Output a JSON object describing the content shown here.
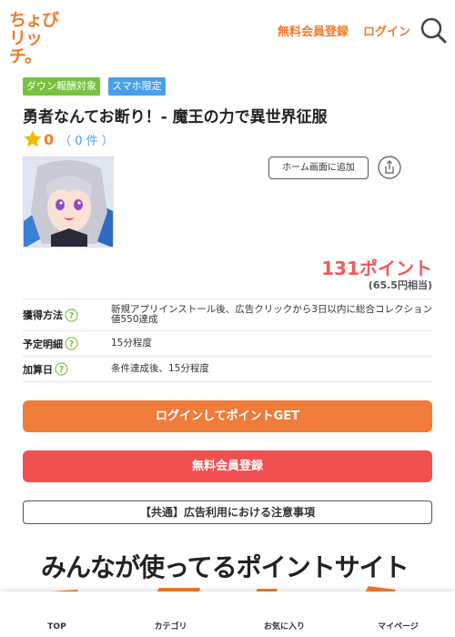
{
  "header": {
    "logo_line1": "ちょび",
    "logo_line2": "リッチ。",
    "register_label": "無料会員登録",
    "login_label": "ログイン",
    "search_icon": "search-icon"
  },
  "badges": [
    "ダウン報酬対象",
    "スマホ限定"
  ],
  "offer": {
    "title": "勇者なんてお断り！- 魔王の力で異世界征服",
    "rating_score": "0",
    "rating_count": "（ 0 件 ）",
    "home_button_label": "ホーム画面に追加",
    "points": "131ポイント",
    "points_yen": "(65.5円相当)"
  },
  "info_rows": [
    {
      "label": "獲得方法",
      "value": "新規アプリインストール後、広告クリックから3日以内に総合コレクション値550達成"
    },
    {
      "label": "予定明細",
      "value": "15分程度"
    },
    {
      "label": "加算日",
      "value": "条件達成後、15分程度"
    }
  ],
  "buttons": {
    "login_get": "ログインしてポイントGET",
    "register": "無料会員登録",
    "notice": "【共通】広告利用における注意事項"
  },
  "banner": {
    "text": "みんなが使ってるポイントサイト"
  },
  "bottom_nav": [
    "TOP",
    "カテゴリ",
    "お気に入り",
    "マイページ"
  ],
  "colors": {
    "brand_orange": "#f07c2a",
    "points_red": "#f05a5a",
    "badge_green": "#7ac142",
    "badge_blue": "#4a9fea",
    "login_button": "#f07c3a",
    "register_button": "#f05050"
  }
}
